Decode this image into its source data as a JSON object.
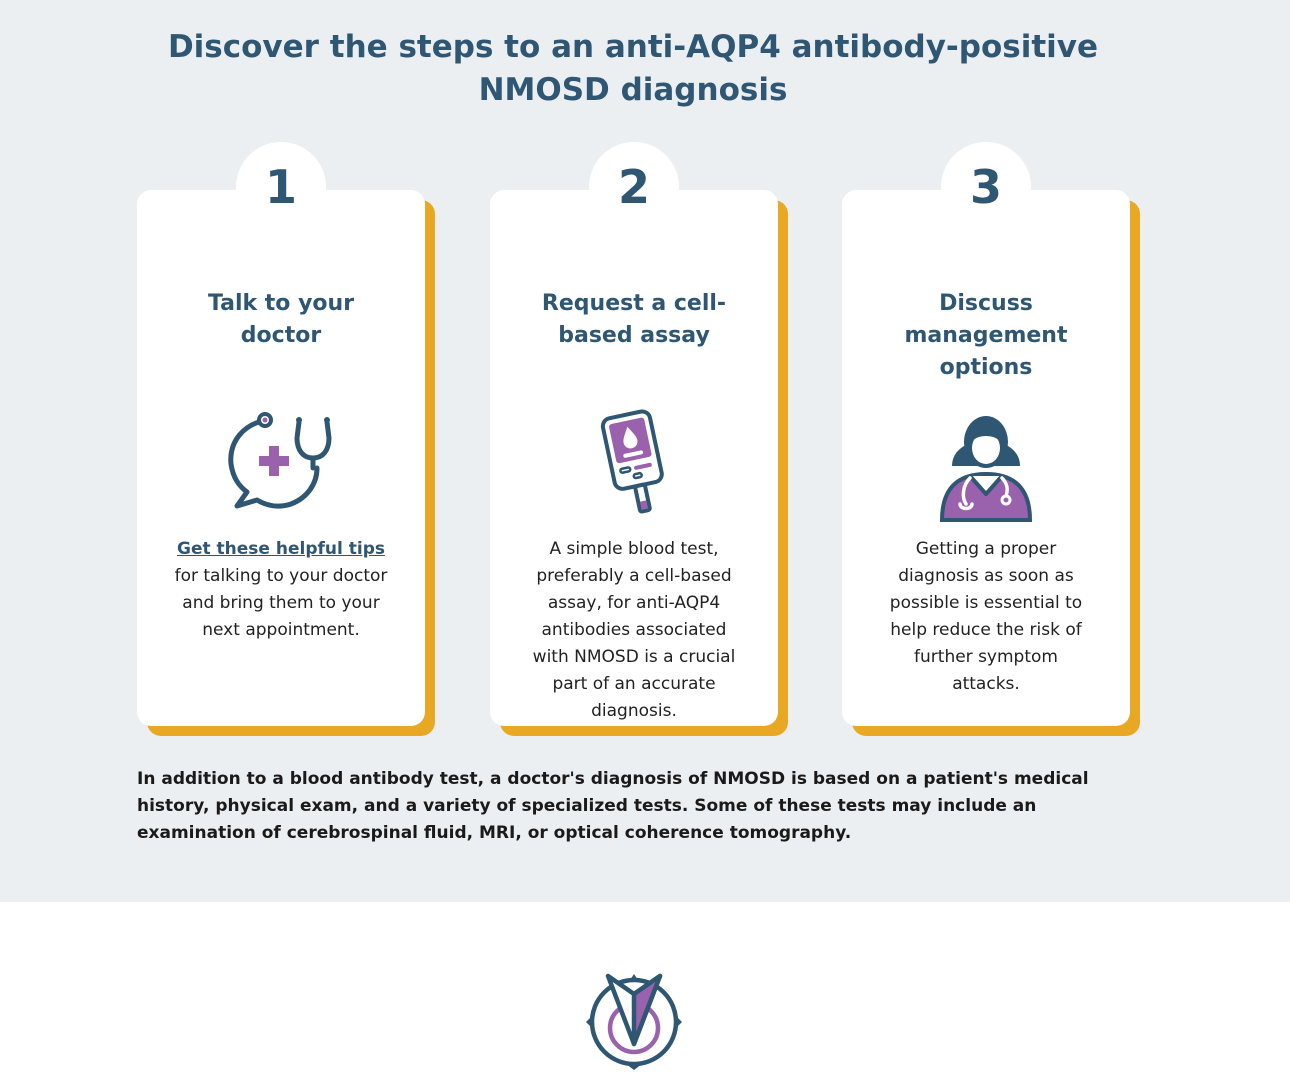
{
  "page": {
    "title": "Discover the steps to an anti-AQP4 antibody-positive NMOSD diagnosis"
  },
  "steps": [
    {
      "number": "1",
      "title": "Talk to your doctor",
      "icon": "stethoscope-chat-icon",
      "link_text": "Get these helpful tips",
      "body": "for talking to your doctor and bring them to your next appointment."
    },
    {
      "number": "2",
      "title": "Request a cell-based assay",
      "icon": "blood-test-device-icon",
      "body": "A simple blood test, preferably a cell-based assay, for anti-AQP4 antibodies associated with NMOSD is a crucial part of an accurate diagnosis."
    },
    {
      "number": "3",
      "title": "Discuss management options",
      "icon": "doctor-icon",
      "body": "Getting a proper diagnosis as soon as possible is essential to help reduce the risk of further symptom attacks."
    }
  ],
  "footnote": "In addition to a blood antibody test, a doctor's diagnosis of NMOSD is based on a patient's medical history, physical exam, and a variety of specialized tests. Some of these tests may include an examination of cerebrospinal fluid, MRI, or optical coherence tomography.",
  "logo": {
    "icon": "compass-logo-icon"
  },
  "colors": {
    "background": "#eceff2",
    "navy": "#2f5673",
    "accent_gold": "#e9a824",
    "purple": "#9a62ad",
    "text": "#222222"
  }
}
